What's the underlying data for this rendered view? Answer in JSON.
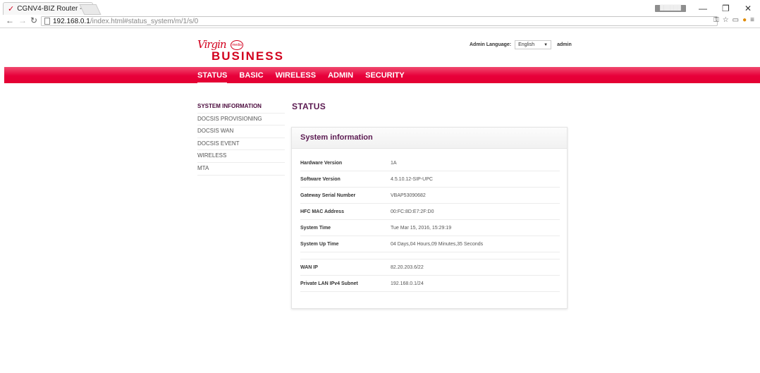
{
  "browser": {
    "tab_title": "CGNV4-BIZ Router -",
    "tab_close": "×",
    "profile_badge": "██████",
    "url_host": "192.168.0.1",
    "url_path": "/index.html#status_system/m/1/s/0",
    "controls": {
      "minimize": "—",
      "restore": "❐",
      "close": "✕"
    },
    "icons": [
      "key-icon",
      "star-icon",
      "cast-icon",
      "extension-icon",
      "menu-icon"
    ]
  },
  "header": {
    "logo_mark": "Virgin",
    "logo_circle": "media",
    "logo_business": "BUSINESS",
    "language_label": "Admin Language:",
    "language_value": "English",
    "user": "admin"
  },
  "nav": {
    "items": [
      {
        "label": "STATUS",
        "active": true
      },
      {
        "label": "BASIC"
      },
      {
        "label": "WIRELESS"
      },
      {
        "label": "ADMIN"
      },
      {
        "label": "SECURITY"
      }
    ]
  },
  "sidebar": {
    "items": [
      {
        "label": "SYSTEM INFORMATION",
        "active": true
      },
      {
        "label": "DOCSIS PROVISIONING"
      },
      {
        "label": "DOCSIS WAN"
      },
      {
        "label": "DOCSIS EVENT"
      },
      {
        "label": "WIRELESS"
      },
      {
        "label": "MTA"
      }
    ]
  },
  "page": {
    "heading": "STATUS",
    "panel_title": "System information",
    "rows": [
      {
        "label": "Hardware Version",
        "value": "1A"
      },
      {
        "label": "Software Version",
        "value": "4.5.10.12-SIP-UPC"
      },
      {
        "label": "Gateway Serial Number",
        "value": "VBAP53090682"
      },
      {
        "label": "HFC MAC Address",
        "value": "00:FC:8D:E7:2F:D0"
      },
      {
        "label": "System Time",
        "value": "Tue Mar 15, 2016, 15:29:19"
      },
      {
        "label": "System Up Time",
        "value": "04 Days,04 Hours,09 Minutes,35 Seconds"
      },
      {
        "label": "WAN IP",
        "value": "82.20.203.6/22"
      },
      {
        "label": "Private LAN IPv4 Subnet",
        "value": "192.168.0.1/24"
      }
    ]
  }
}
